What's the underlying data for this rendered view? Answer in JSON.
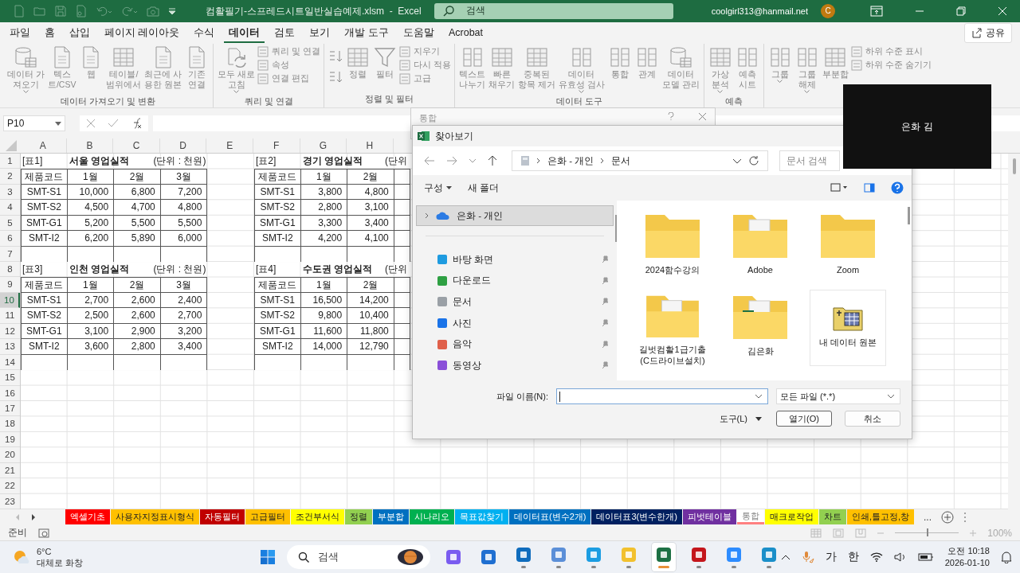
{
  "title_bar": {
    "title": "컴활필기-스프레드시트일반실습예제.xlsm  -  Excel",
    "search_placeholder": "검색",
    "account": "coolgirl313@hanmail.net",
    "avatar": "C"
  },
  "menu": [
    {
      "label": "파일",
      "selected": false
    },
    {
      "label": "홈",
      "selected": false
    },
    {
      "label": "삽입",
      "selected": false
    },
    {
      "label": "페이지 레이아웃",
      "selected": false
    },
    {
      "label": "수식",
      "selected": false
    },
    {
      "label": "데이터",
      "selected": true
    },
    {
      "label": "검토",
      "selected": false
    },
    {
      "label": "보기",
      "selected": false
    },
    {
      "label": "개발 도구",
      "selected": false
    },
    {
      "label": "도움말",
      "selected": false
    },
    {
      "label": "Acrobat",
      "selected": false
    }
  ],
  "share": "공유",
  "ribbon": [
    {
      "label": "데이터 가져오기 및 변환",
      "items": [
        {
          "kind": "large",
          "label": "데이터 가\n져오기",
          "dropdown": true
        },
        {
          "kind": "large",
          "label": "텍스\n트/CSV",
          "dropdown": false
        },
        {
          "kind": "large",
          "label": "웹",
          "dropdown": false
        },
        {
          "kind": "large",
          "label": "테이블/\n범위에서",
          "dropdown": false
        },
        {
          "kind": "large",
          "label": "최근에 사\n용한 원본",
          "dropdown": false
        },
        {
          "kind": "large",
          "label": "기존\n연결",
          "dropdown": false
        }
      ]
    },
    {
      "label": "쿼리 및 연결",
      "items": [
        {
          "kind": "large",
          "label": "모두 새로\n고침",
          "dropdown": true
        },
        {
          "kind": "stack",
          "items": [
            "쿼리 및 연결",
            "속성",
            "연결 편집"
          ]
        }
      ]
    },
    {
      "label": "정렬 및 필터",
      "items": [
        {
          "kind": "sort"
        },
        {
          "kind": "large",
          "label": "정렬",
          "dropdown": false
        },
        {
          "kind": "large",
          "label": "필터",
          "dropdown": false
        },
        {
          "kind": "stack",
          "items": [
            "지우기",
            "다시 적용",
            "고급"
          ]
        }
      ]
    },
    {
      "label": "데이터 도구",
      "items": [
        {
          "kind": "large",
          "label": "텍스트\n나누기",
          "dropdown": false
        },
        {
          "kind": "large",
          "label": "빠른\n채우기",
          "dropdown": false
        },
        {
          "kind": "large",
          "label": "중복된\n항목 제거",
          "dropdown": false
        },
        {
          "kind": "large",
          "label": "데이터\n유효성 검사",
          "dropdown": true
        },
        {
          "kind": "large",
          "label": "통합",
          "dropdown": false
        },
        {
          "kind": "large",
          "label": "관계",
          "dropdown": false
        },
        {
          "kind": "large",
          "label": "데이터\n모델 관리",
          "dropdown": false
        }
      ]
    },
    {
      "label": "예측",
      "items": [
        {
          "kind": "large",
          "label": "가상\n분석",
          "dropdown": true
        },
        {
          "kind": "large",
          "label": "예측\n시트",
          "dropdown": false
        }
      ]
    },
    {
      "items": [
        {
          "kind": "large",
          "label": "그룹",
          "dropdown": true
        },
        {
          "kind": "large",
          "label": "그룹\n해제",
          "dropdown": true
        },
        {
          "kind": "large",
          "label": "부분합",
          "dropdown": false
        },
        {
          "kind": "stack",
          "items": [
            "하위 수준 표시",
            "하위 수준 숨기기"
          ]
        }
      ]
    }
  ],
  "formula_bar": {
    "name_box": "P10"
  },
  "sheet": {
    "columns": [
      "A",
      "B",
      "C",
      "D",
      "E",
      "F",
      "G",
      "H"
    ],
    "rows": [
      {
        "label": "1",
        "selected": false
      },
      {
        "label": "2",
        "selected": false
      },
      {
        "label": "3",
        "selected": false
      },
      {
        "label": "4",
        "selected": false
      },
      {
        "label": "5",
        "selected": false
      },
      {
        "label": "6",
        "selected": false
      },
      {
        "label": "7",
        "selected": false
      },
      {
        "label": "8",
        "selected": false
      },
      {
        "label": "9",
        "selected": false
      },
      {
        "label": "10",
        "selected": true
      },
      {
        "label": "11",
        "selected": false
      },
      {
        "label": "12",
        "selected": false
      },
      {
        "label": "13",
        "selected": false
      },
      {
        "label": "14",
        "selected": false
      },
      {
        "label": "15",
        "selected": false
      },
      {
        "label": "16",
        "selected": false
      },
      {
        "label": "17",
        "selected": false
      },
      {
        "label": "18",
        "selected": false
      },
      {
        "label": "19",
        "selected": false
      },
      {
        "label": "20",
        "selected": false
      },
      {
        "label": "21",
        "selected": false
      },
      {
        "label": "22",
        "selected": false
      },
      {
        "label": "23",
        "selected": false
      }
    ],
    "tables": [
      {
        "label": "[표1]",
        "title": "서울 영업실적",
        "unit": "(단위 : 천원)",
        "header": [
          "제품코드",
          "1월",
          "2월",
          "3월"
        ],
        "rows": [
          [
            "SMT-S1",
            "10,000",
            "6,800",
            "7,200"
          ],
          [
            "SMT-S2",
            "4,500",
            "4,700",
            "4,800"
          ],
          [
            "SMT-G1",
            "5,200",
            "5,500",
            "5,500"
          ],
          [
            "SMT-I2",
            "6,200",
            "5,890",
            "6,000"
          ]
        ]
      },
      {
        "label": "[표2]",
        "title": "경기 영업실적",
        "unit": "(단위",
        "header": [
          "제품코드",
          "1월",
          "2월"
        ],
        "rows": [
          [
            "SMT-S1",
            "3,800",
            "4,800"
          ],
          [
            "SMT-S2",
            "2,800",
            "3,100"
          ],
          [
            "SMT-G1",
            "3,300",
            "3,400"
          ],
          [
            "SMT-I2",
            "4,200",
            "4,100"
          ]
        ]
      },
      {
        "label": "[표3]",
        "title": "인천 영업실적",
        "unit": "(단위 : 천원)",
        "header": [
          "제품코드",
          "1월",
          "2월",
          "3월"
        ],
        "rows": [
          [
            "SMT-S1",
            "2,700",
            "2,600",
            "2,400"
          ],
          [
            "SMT-S2",
            "2,500",
            "2,600",
            "2,700"
          ],
          [
            "SMT-G1",
            "3,100",
            "2,900",
            "3,200"
          ],
          [
            "SMT-I2",
            "3,600",
            "2,800",
            "3,400"
          ]
        ]
      },
      {
        "label": "[표4]",
        "title": "수도권 영업실적",
        "unit": "(단위",
        "header": [
          "제품코드",
          "1월",
          "2월"
        ],
        "rows": [
          [
            "SMT-S1",
            "16,500",
            "14,200"
          ],
          [
            "SMT-S2",
            "9,800",
            "10,400"
          ],
          [
            "SMT-G1",
            "11,600",
            "11,800"
          ],
          [
            "SMT-I2",
            "14,000",
            "12,790"
          ]
        ]
      }
    ]
  },
  "sheet_tabs": [
    {
      "label": "엑셀기초",
      "color": "#ff0000",
      "selected": false
    },
    {
      "label": "사용자지정표시형식",
      "color": "#ffc000",
      "selected": false
    },
    {
      "label": "자동필터",
      "color": "#c00000",
      "selected": false
    },
    {
      "label": "고급필터",
      "color": "#ffc000",
      "selected": false
    },
    {
      "label": "조건부서식",
      "color": "#ffff00",
      "selected": false
    },
    {
      "label": "정렬",
      "color": "#92d050",
      "selected": false
    },
    {
      "label": "부분합",
      "color": "#0070c0",
      "selected": false
    },
    {
      "label": "시나리오",
      "color": "#00b050",
      "selected": false
    },
    {
      "label": "목표값찾기",
      "color": "#00b0f0",
      "selected": false
    },
    {
      "label": "데이터표(변수2개)",
      "color": "#0070c0",
      "selected": false
    },
    {
      "label": "데이터표3(변수한개)",
      "color": "#002060",
      "selected": false
    },
    {
      "label": "피벗테이블",
      "color": "#7030a0",
      "selected": false
    },
    {
      "label": "통합",
      "color": "#ff8080",
      "selected": true
    },
    {
      "label": "매크로작업",
      "color": "#ffff00",
      "selected": false
    },
    {
      "label": "차트",
      "color": "#92d050",
      "selected": false
    },
    {
      "label": "인쇄,틀고정,창",
      "color": "#ffc000",
      "selected": false
    }
  ],
  "more_tabs": "...",
  "status_bar": {
    "status": "준비",
    "zoom": {
      "level": 0.5,
      "reading": "100%"
    }
  },
  "consolidate_dialog": {
    "title": "통합"
  },
  "browse_dialog": {
    "title": "찾아보기",
    "path": [
      "은화 - 개인",
      "문서"
    ],
    "search_placeholder": "문서 검색",
    "organize": "구성",
    "new_folder": "새 폴더",
    "nav": [
      {
        "label": "은화 - 개인",
        "selected": true
      }
    ],
    "quick_access": [
      {
        "label": "바탕 화면",
        "pinned": true
      },
      {
        "label": "다운로드",
        "pinned": true
      },
      {
        "label": "문서",
        "pinned": true
      },
      {
        "label": "사진",
        "pinned": true
      },
      {
        "label": "음악",
        "pinned": true
      },
      {
        "label": "동영상",
        "pinned": true
      }
    ],
    "files": [
      {
        "name": "2024함수강의",
        "selected": false
      },
      {
        "name": "Adobe",
        "selected": false
      },
      {
        "name": "Zoom",
        "selected": false
      },
      {
        "name": "길벗컴활1급기출(C드라이브설치)",
        "selected": false
      },
      {
        "name": "김은화",
        "selected": false
      },
      {
        "name": "내 데이터 원본",
        "selected": true
      }
    ],
    "file_name_label": "파일 이름(N):",
    "file_type": "모든 파일 (*.*)",
    "tools": "도구(L)",
    "open": "열기(O)",
    "cancel": "취소"
  },
  "video_tile": {
    "name": "은화 김"
  },
  "taskbar": {
    "temperature": "6°C",
    "weather": "대체로 화창",
    "search_placeholder": "검색",
    "apps": [
      {
        "running": false,
        "active": false
      },
      {
        "running": false,
        "active": false
      },
      {
        "running": true,
        "active": false
      },
      {
        "running": true,
        "active": false
      },
      {
        "running": true,
        "active": false
      },
      {
        "running": true,
        "active": false
      },
      {
        "running": true,
        "active": true
      },
      {
        "running": true,
        "active": false
      },
      {
        "running": true,
        "active": false
      },
      {
        "running": true,
        "active": false
      }
    ],
    "ime_mode": "가",
    "ime_lang": "한",
    "time": "오전 10:18",
    "date": "2026-01-10"
  }
}
